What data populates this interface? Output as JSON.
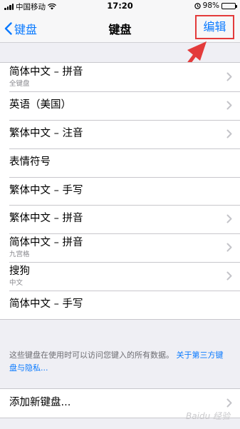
{
  "status": {
    "carrier": "中国移动",
    "time": "17:20",
    "battery": "98%",
    "battery_level": 0.98
  },
  "nav": {
    "back_label": "键盘",
    "title": "键盘",
    "edit_label": "编辑"
  },
  "keyboards": [
    {
      "title": "简体中文 – 拼音",
      "subtitle": "全键盘"
    },
    {
      "title": "英语（美国）"
    },
    {
      "title": "繁体中文 – 注音"
    },
    {
      "title": "表情符号"
    },
    {
      "title": "繁体中文 – 手写"
    },
    {
      "title": "繁体中文 – 拼音"
    },
    {
      "title": "简体中文 – 拼音",
      "subtitle": "九宫格"
    },
    {
      "title": "搜狗",
      "subtitle": "中文"
    },
    {
      "title": "简体中文 – 手写"
    }
  ],
  "footer": {
    "text": "这些键盘在使用时可以访问您键入的所有数据。",
    "link": "关于第三方键盘与隐私..."
  },
  "add_keyboard": {
    "label": "添加新键盘..."
  },
  "watermark": "Baidu 经验",
  "colors": {
    "accent": "#0a7aff",
    "annotation": "#e33b3b",
    "background": "#efeff4"
  }
}
